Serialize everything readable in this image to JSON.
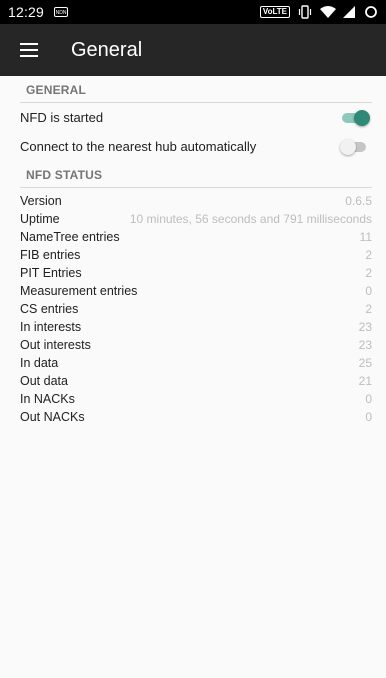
{
  "status_bar": {
    "time": "12:29",
    "notification_icon": "ndn-notification-icon",
    "volte": "VoLTE"
  },
  "app_bar": {
    "title": "General",
    "menu_icon": "hamburger-menu-icon"
  },
  "general": {
    "header": "GENERAL",
    "items": [
      {
        "label": "NFD is started",
        "checked": true
      },
      {
        "label": "Connect to the nearest hub automatically",
        "checked": false
      }
    ]
  },
  "nfd_status": {
    "header": "NFD STATUS",
    "rows": [
      {
        "label": "Version",
        "value": "0.6.5"
      },
      {
        "label": "Uptime",
        "value": "10 minutes, 56 seconds and 791 milliseconds"
      },
      {
        "label": "NameTree entries",
        "value": "11"
      },
      {
        "label": "FIB entries",
        "value": "2"
      },
      {
        "label": "PIT Entries",
        "value": "2"
      },
      {
        "label": "Measurement entries",
        "value": "0"
      },
      {
        "label": "CS entries",
        "value": "2"
      },
      {
        "label": "In interests",
        "value": "23"
      },
      {
        "label": "Out interests",
        "value": "23"
      },
      {
        "label": "In data",
        "value": "25"
      },
      {
        "label": "Out data",
        "value": "21"
      },
      {
        "label": "In NACKs",
        "value": "0"
      },
      {
        "label": "Out NACKs",
        "value": "0"
      }
    ]
  },
  "colors": {
    "accent": "#2e8a77",
    "app_bar": "#262626",
    "background": "#fafafa"
  }
}
